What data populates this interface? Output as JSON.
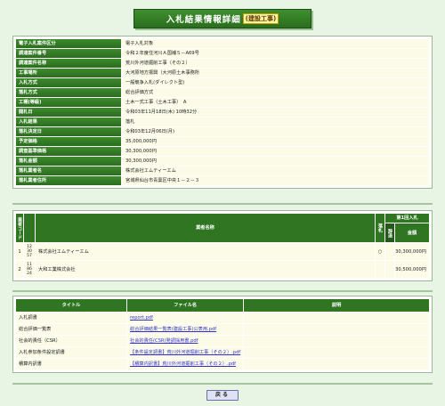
{
  "title": {
    "main": "入札結果情報詳細",
    "sub": "(建設工事)"
  },
  "details": [
    {
      "label": "電子入札案件区分",
      "value": "電子入札対象"
    },
    {
      "label": "調達案件番号",
      "value": "令和２年度住河川Ａ国補５－A69号"
    },
    {
      "label": "調達案件名称",
      "value": "荒川外河道掘削工事（その２）"
    },
    {
      "label": "工事場所",
      "value": "大河原地方振興（大河原土木事務所"
    },
    {
      "label": "入札方式",
      "value": "一般競争入札(ダイレクト型)"
    },
    {
      "label": "落札方式",
      "value": "総合評価方式"
    },
    {
      "label": "工種(等級)",
      "value": "土木一式工事（土木工事）　A"
    },
    {
      "label": "開札日",
      "value": "令和03年11月18日(木) 10時32分"
    },
    {
      "label": "入札結果",
      "value": "落札"
    },
    {
      "label": "落札決定日",
      "value": "令和03年12月06日(月)"
    },
    {
      "label": "予定価格",
      "value": "35,000,000円"
    },
    {
      "label": "調査基準価格",
      "value": "30,300,000円"
    },
    {
      "label": "落札金額",
      "value": "30,300,000円"
    },
    {
      "label": "落札業者名",
      "value": "株式会社エムティーエム"
    },
    {
      "label": "落札業者住所",
      "value": "宮城県仙台市青葉区中央１－２－３"
    }
  ],
  "bidders": {
    "header": {
      "no": "業者コード",
      "name": "業者名称",
      "winner": "落札",
      "round": "第1回入札",
      "excluded": "辞退",
      "amount": "金額"
    },
    "rows": [
      {
        "idx": "1",
        "code": "12 30 57",
        "name": "株式会社エムティーエム",
        "winner": "○",
        "amount": "30,300,000円"
      },
      {
        "idx": "2",
        "code": "11 86 24",
        "name": "大和工業株式会社",
        "winner": "",
        "amount": "30,500,000円"
      }
    ]
  },
  "documents": {
    "header": {
      "title": "タイトル",
      "file": "ファイル名",
      "note": "説明"
    },
    "rows": [
      {
        "title": "入札調書",
        "file": "report.pdf"
      },
      {
        "title": "総合評価一覧表",
        "file": "総合評価結果一覧表(建設工事)公表用.pdf"
      },
      {
        "title": "社会的責任（CSR）",
        "file": "社会的責任(CSR)発調採用書.pdf"
      },
      {
        "title": "入札参加条件設定調書",
        "file": "【条件設定調書】荒川外河道掘削工事（その２）.pdf"
      },
      {
        "title": "積算内訳書",
        "file": "【積算内訳書】荒川外河道掘削工事（その２）.pdf"
      }
    ]
  },
  "back_button": "戻る"
}
